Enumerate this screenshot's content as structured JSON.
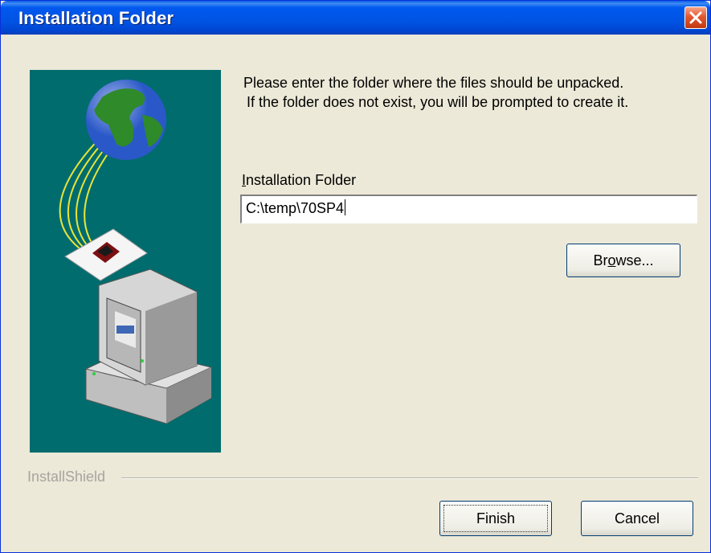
{
  "window": {
    "title": "Installation Folder",
    "close_icon": "close-icon",
    "titlebar_color": "#0054e3"
  },
  "panel": {
    "background": "#006c6e",
    "illustration": [
      "globe-icon",
      "cable-icon",
      "disk-icon",
      "computer-icon"
    ]
  },
  "instructions": {
    "line1": "Please enter the folder where the files should be unpacked.",
    "line2": "If the folder does not exist, you will be prompted to create it."
  },
  "folder": {
    "label_first": "I",
    "label_rest": "nstallation Folder",
    "value": "C:\\temp\\70SP4"
  },
  "buttons": {
    "browse_a": "Br",
    "browse_u": "o",
    "browse_b": "wse...",
    "finish": "Finish",
    "cancel": "Cancel"
  },
  "footer": {
    "brand": "InstallShield"
  }
}
